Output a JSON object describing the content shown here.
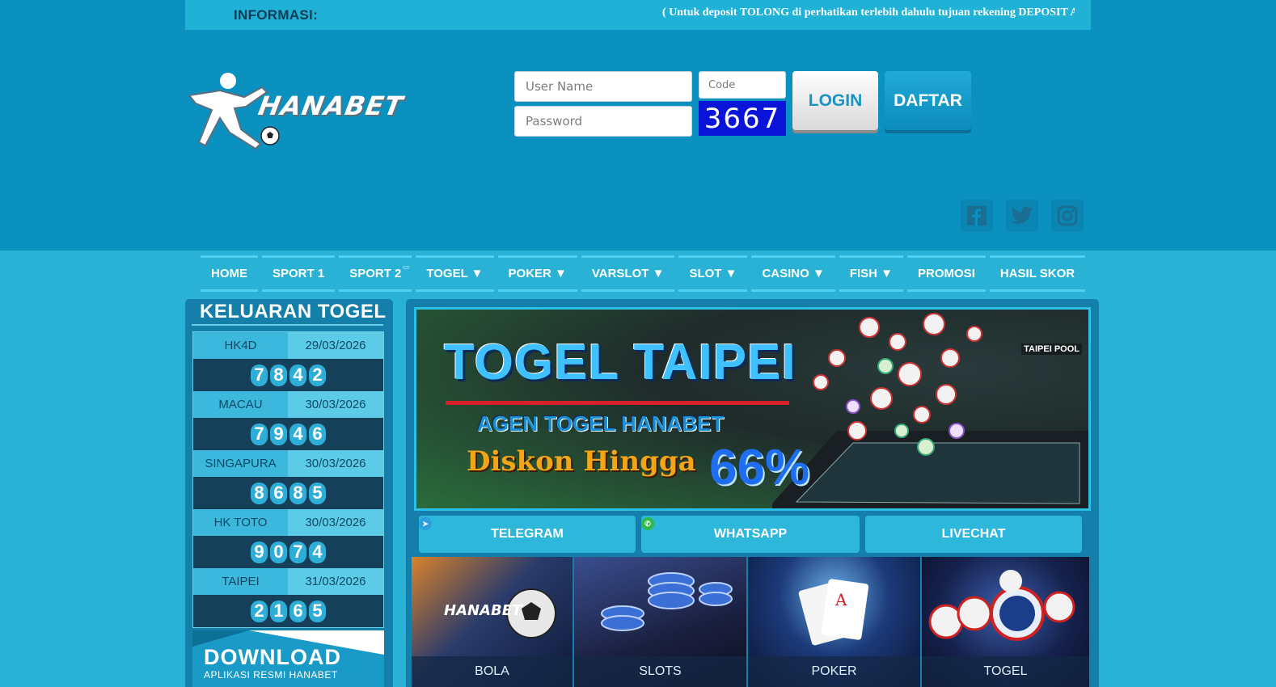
{
  "info": {
    "label": "INFORMASI:",
    "marquee": "( Untuk deposit TOLONG di perhatikan terlebih dahulu tujuan rekening DEPOSIT Atau di"
  },
  "brand": {
    "name": "HANABET"
  },
  "login": {
    "username_placeholder": "User Name",
    "password_placeholder": "Password",
    "code_placeholder": "Code",
    "captcha": "3667",
    "login_label": "LOGIN",
    "register_label": "DAFTAR"
  },
  "nav": {
    "items": [
      {
        "label": "HOME"
      },
      {
        "label": "SPORT 1"
      },
      {
        "label": "SPORT 2"
      },
      {
        "label": "TOGEL ▼"
      },
      {
        "label": "POKER ▼"
      },
      {
        "label": "VARSLOT ▼"
      },
      {
        "label": "SLOT ▼"
      },
      {
        "label": "CASINO ▼"
      },
      {
        "label": "FISH ▼"
      },
      {
        "label": "PROMOSI"
      },
      {
        "label": "HASIL SKOR"
      }
    ]
  },
  "sidebar": {
    "title": "KELUARAN TOGEL",
    "results": [
      {
        "market": "HK4D",
        "date": "29/03/2026",
        "digits": [
          "7",
          "8",
          "4",
          "2"
        ]
      },
      {
        "market": "MACAU",
        "date": "30/03/2026",
        "digits": [
          "7",
          "9",
          "4",
          "6"
        ]
      },
      {
        "market": "SINGAPURA",
        "date": "30/03/2026",
        "digits": [
          "8",
          "6",
          "8",
          "5"
        ]
      },
      {
        "market": "HK TOTO",
        "date": "30/03/2026",
        "digits": [
          "9",
          "0",
          "7",
          "4"
        ]
      },
      {
        "market": "TAIPEI",
        "date": "31/03/2026",
        "digits": [
          "2",
          "1",
          "6",
          "5"
        ]
      }
    ],
    "download_title": "DOWNLOAD",
    "download_sub": "APLIKASI RESMI HANABET"
  },
  "banner": {
    "title": "TOGEL TAIPEI",
    "subtitle": "AGEN TOGEL HANABET",
    "discount": "Diskon Hingga",
    "percent": "66%",
    "pool_logo": "TAIPEI POOL"
  },
  "contacts": [
    {
      "label": "TELEGRAM"
    },
    {
      "label": "WHATSAPP"
    },
    {
      "label": "LIVECHAT"
    }
  ],
  "games": [
    {
      "label": "BOLA"
    },
    {
      "label": "SLOTS"
    },
    {
      "label": "POKER"
    },
    {
      "label": "TOGEL"
    }
  ],
  "colors": {
    "header_bg": "#0a91c0",
    "page_bg": "#29b2d6",
    "panel_bg": "#147fa9",
    "captcha_bg": "#0a14d8",
    "accent": "#2cb7db"
  },
  "icons": [
    "facebook-icon",
    "twitter-icon",
    "instagram-icon",
    "telegram-icon",
    "whatsapp-icon",
    "soccer-ball-icon"
  ]
}
